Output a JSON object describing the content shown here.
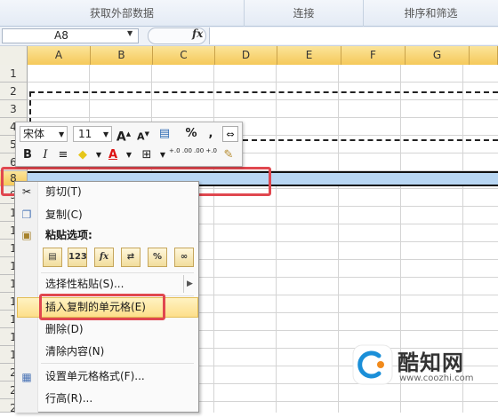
{
  "ribbon": {
    "groups": [
      "获取外部数据",
      "连接",
      "排序和筛选"
    ]
  },
  "formula_bar": {
    "name_box": "A8",
    "fx_label": "fx",
    "content": ""
  },
  "columns": [
    "A",
    "B",
    "C",
    "D",
    "E",
    "F",
    "G"
  ],
  "rows": [
    "1",
    "2",
    "3",
    "4",
    "5",
    "6",
    "7",
    "8",
    "9",
    "1",
    "1",
    "1",
    "1",
    "1",
    "1",
    "1",
    "1",
    "1",
    "1",
    "2",
    "2",
    "2"
  ],
  "mini_toolbar": {
    "font_name": "宋体",
    "font_size": "11",
    "bold": "B",
    "italic": "I",
    "percent": "%",
    "comma": ",",
    "grow_font": "A",
    "shrink_font": "A",
    "dec_more": "+.0 .00",
    "dec_less": ".00 +.0"
  },
  "context_menu": {
    "cut": "剪切(T)",
    "copy": "复制(C)",
    "paste_options": "粘贴选项:",
    "paste_buttons": [
      "",
      "123",
      "fx",
      "",
      "%",
      ""
    ],
    "paste_special": "选择性粘贴(S)...",
    "insert_copied": "插入复制的单元格(E)",
    "delete": "删除(D)",
    "clear": "清除内容(N)",
    "format_cells": "设置单元格格式(F)...",
    "row_height": "行高(R)..."
  },
  "watermark": {
    "brand": "酷知网",
    "url": "www.coozhi.com"
  },
  "colors": {
    "selection": "#b8d6f3",
    "highlight_frame": "#e0474f",
    "header_active": "#f5c95a"
  }
}
